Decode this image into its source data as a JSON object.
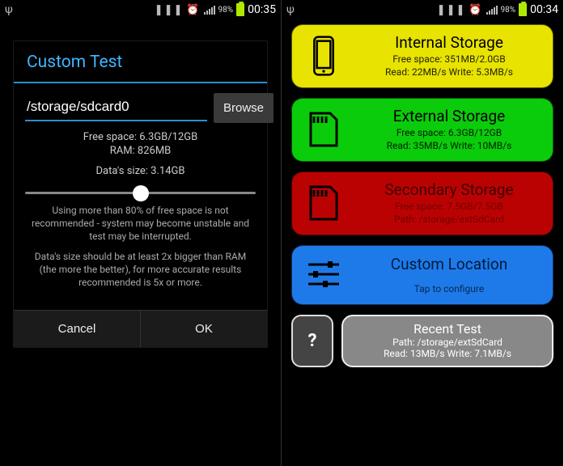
{
  "left": {
    "status": {
      "battery_pct": "98%",
      "time": "00:35"
    },
    "dialog": {
      "title": "Custom Test",
      "path_value": "/storage/sdcard0",
      "browse_label": "Browse",
      "free_space": "Free space: 6.3GB/12GB",
      "ram": "RAM: 826MB",
      "data_size": "Data's size: 3.14GB",
      "slider_value": 50,
      "note1": "Using more than 80% of free space is not recommended - system may become unstable and test may be interrupted.",
      "note2": "Data's size should be at least 2x bigger than RAM (the more the better), for more accurate results recommended is 5x or more.",
      "cancel_label": "Cancel",
      "ok_label": "OK"
    }
  },
  "right": {
    "status": {
      "battery_pct": "98%",
      "time": "00:34"
    },
    "cards": {
      "internal": {
        "title": "Internal Storage",
        "line1": "Free space: 351MB/2.0GB",
        "line2": "Read: 22MB/s Write: 5.3MB/s"
      },
      "external": {
        "title": "External Storage",
        "line1": "Free space: 6.3GB/12GB",
        "line2": "Read: 35MB/s Write: 10MB/s"
      },
      "secondary": {
        "title": "Secondary Storage",
        "line1": "Free space: 7.5GB/7.5GB",
        "line2": "Path: /storage/extSdCard"
      },
      "custom": {
        "title": "Custom Location",
        "line1": "Tap to configure"
      }
    },
    "help_label": "?",
    "recent": {
      "title": "Recent Test",
      "line1": "Path: /storage/extSdCard",
      "line2": "Read: 13MB/s Write: 7.1MB/s"
    }
  }
}
